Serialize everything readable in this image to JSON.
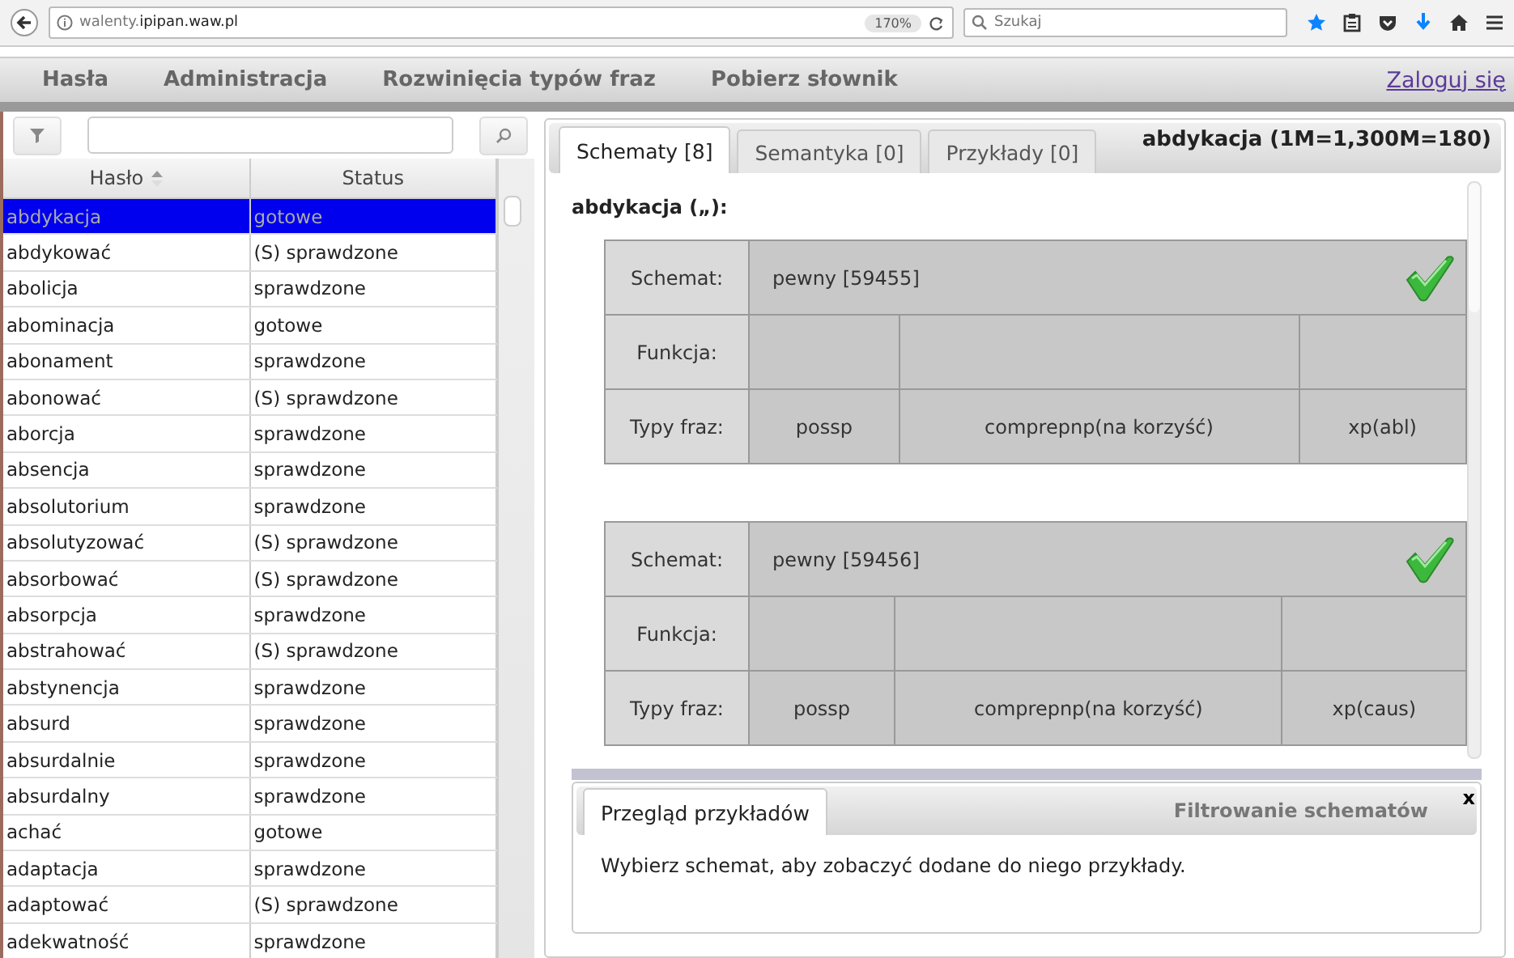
{
  "browser": {
    "url_prefix": "walenty.",
    "url_domain": "ipipan.waw.pl",
    "zoom": "170%",
    "search": {
      "placeholder": "Szukaj"
    }
  },
  "nav": {
    "items": [
      "Hasła",
      "Administracja",
      "Rozwinięcia typów fraz",
      "Pobierz słownik"
    ],
    "login": "Zaloguj się"
  },
  "entries": {
    "columns": [
      {
        "label": "Hasło",
        "sorted": true
      },
      {
        "label": "Status",
        "sorted": false
      }
    ],
    "rows": [
      {
        "entry": "abdykacja",
        "status": "gotowe",
        "selected": true
      },
      {
        "entry": "abdykować",
        "status": "(S) sprawdzone",
        "selected": false
      },
      {
        "entry": "abolicja",
        "status": "sprawdzone",
        "selected": false
      },
      {
        "entry": "abominacja",
        "status": "gotowe",
        "selected": false
      },
      {
        "entry": "abonament",
        "status": "sprawdzone",
        "selected": false
      },
      {
        "entry": "abonować",
        "status": "(S) sprawdzone",
        "selected": false
      },
      {
        "entry": "aborcja",
        "status": "sprawdzone",
        "selected": false
      },
      {
        "entry": "absencja",
        "status": "sprawdzone",
        "selected": false
      },
      {
        "entry": "absolutorium",
        "status": "sprawdzone",
        "selected": false
      },
      {
        "entry": "absolutyzować",
        "status": "(S) sprawdzone",
        "selected": false
      },
      {
        "entry": "absorbować",
        "status": "(S) sprawdzone",
        "selected": false
      },
      {
        "entry": "absorpcja",
        "status": "sprawdzone",
        "selected": false
      },
      {
        "entry": "abstrahować",
        "status": "(S) sprawdzone",
        "selected": false
      },
      {
        "entry": "abstynencja",
        "status": "sprawdzone",
        "selected": false
      },
      {
        "entry": "absurd",
        "status": "sprawdzone",
        "selected": false
      },
      {
        "entry": "absurdalnie",
        "status": "sprawdzone",
        "selected": false
      },
      {
        "entry": "absurdalny",
        "status": "sprawdzone",
        "selected": false
      },
      {
        "entry": "achać",
        "status": "gotowe",
        "selected": false
      },
      {
        "entry": "adaptacja",
        "status": "sprawdzone",
        "selected": false
      },
      {
        "entry": "adaptować",
        "status": "(S) sprawdzone",
        "selected": false
      },
      {
        "entry": "adekwatność",
        "status": "sprawdzone",
        "selected": false
      }
    ]
  },
  "detail": {
    "tabs": [
      {
        "label": "Schematy [8]",
        "selected": true
      },
      {
        "label": "Semantyka [0]",
        "selected": false
      },
      {
        "label": "Przykłady [0]",
        "selected": false
      }
    ],
    "title": "abdykacja (1M=1,300M=180)",
    "heading": "abdykacja („):",
    "schemas": [
      {
        "schema_label": "Schemat:",
        "schema": "pewny [59455]",
        "approved": true,
        "function_label": "Funkcja:",
        "types_label": "Typy fraz:",
        "phrases": [
          "possp",
          "comprepnp(na korzyść)",
          "xp(abl)"
        ]
      },
      {
        "schema_label": "Schemat:",
        "schema": "pewny [59456]",
        "approved": true,
        "function_label": "Funkcja:",
        "types_label": "Typy fraz:",
        "phrases": [
          "possp",
          "comprepnp(na korzyść)",
          "xp(caus)"
        ]
      }
    ]
  },
  "examples": {
    "tabs": [
      {
        "label": "Przegląd przykładów",
        "selected": true
      }
    ],
    "filter_title": "Filtrowanie schematów",
    "close": "x",
    "message": "Wybierz schemat, aby zobaczyć dodane do niego przykłady."
  }
}
